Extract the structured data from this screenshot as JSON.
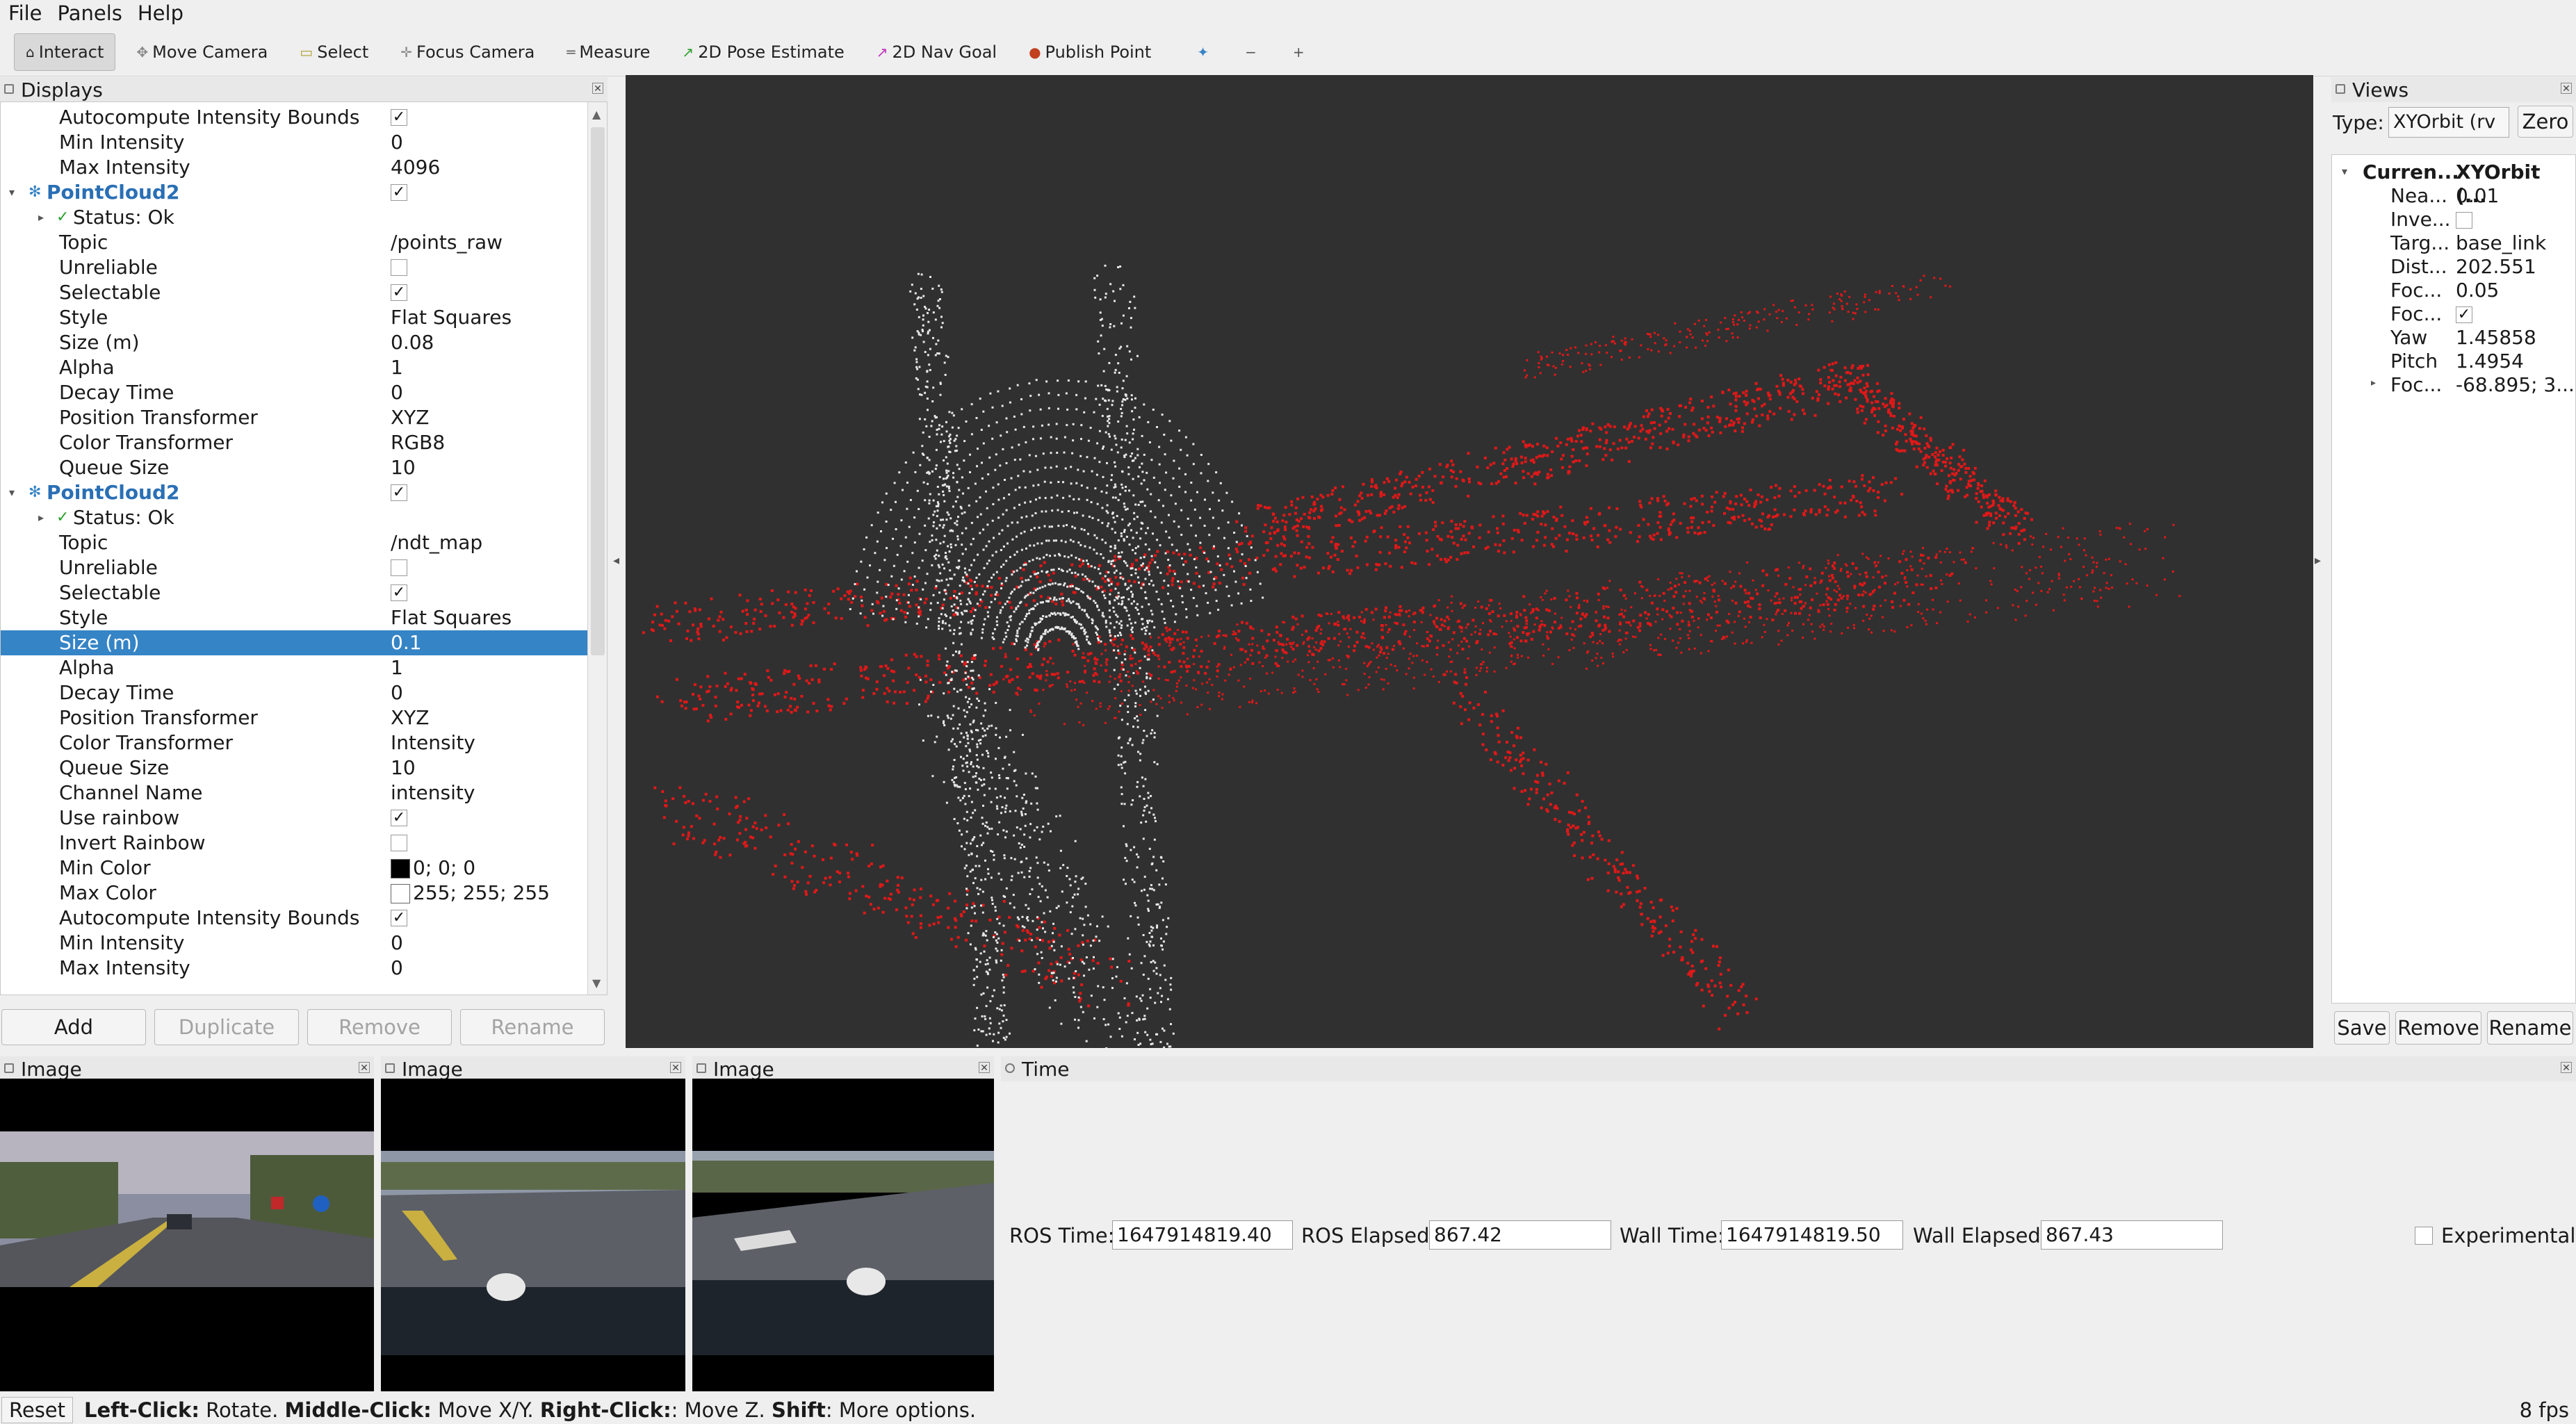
{
  "menu": {
    "file": "File",
    "panels": "Panels",
    "help": "Help"
  },
  "toolbar": {
    "interact": "Interact",
    "move_camera": "Move Camera",
    "select": "Select",
    "focus_camera": "Focus Camera",
    "measure": "Measure",
    "pose_estimate": "2D Pose Estimate",
    "nav_goal": "2D Nav Goal",
    "publish_point": "Publish Point"
  },
  "displays": {
    "title": "Displays",
    "rows": [
      {
        "key": "Autocompute Intensity Bounds",
        "checked": true
      },
      {
        "key": "Min Intensity",
        "value": "0"
      },
      {
        "key": "Max Intensity",
        "value": "4096"
      },
      {
        "key": "PointCloud2",
        "checked": true,
        "header": true
      },
      {
        "key": "Status: Ok",
        "status": true
      },
      {
        "key": "Topic",
        "value": "/points_raw"
      },
      {
        "key": "Unreliable",
        "checked": false
      },
      {
        "key": "Selectable",
        "checked": true
      },
      {
        "key": "Style",
        "value": "Flat Squares"
      },
      {
        "key": "Size (m)",
        "value": "0.08"
      },
      {
        "key": "Alpha",
        "value": "1"
      },
      {
        "key": "Decay Time",
        "value": "0"
      },
      {
        "key": "Position Transformer",
        "value": "XYZ"
      },
      {
        "key": "Color Transformer",
        "value": "RGB8"
      },
      {
        "key": "Queue Size",
        "value": "10"
      },
      {
        "key": "PointCloud2",
        "checked": true,
        "header": true
      },
      {
        "key": "Status: Ok",
        "status": true
      },
      {
        "key": "Topic",
        "value": "/ndt_map"
      },
      {
        "key": "Unreliable",
        "checked": false
      },
      {
        "key": "Selectable",
        "checked": true
      },
      {
        "key": "Style",
        "value": "Flat Squares"
      },
      {
        "key": "Size (m)",
        "value": "0.1",
        "selected": true
      },
      {
        "key": "Alpha",
        "value": "1"
      },
      {
        "key": "Decay Time",
        "value": "0"
      },
      {
        "key": "Position Transformer",
        "value": "XYZ"
      },
      {
        "key": "Color Transformer",
        "value": "Intensity"
      },
      {
        "key": "Queue Size",
        "value": "10"
      },
      {
        "key": "Channel Name",
        "value": "intensity"
      },
      {
        "key": "Use rainbow",
        "checked": true
      },
      {
        "key": "Invert Rainbow",
        "checked": false
      },
      {
        "key": "Min Color",
        "value": "0; 0; 0",
        "swatch": "#000000"
      },
      {
        "key": "Max Color",
        "value": "255; 255; 255",
        "swatch": "#ffffff"
      },
      {
        "key": "Autocompute Intensity Bounds",
        "checked": true
      },
      {
        "key": "Min Intensity",
        "value": "0"
      },
      {
        "key": "Max Intensity",
        "value": "0"
      }
    ],
    "buttons": {
      "add": "Add",
      "duplicate": "Duplicate",
      "remove": "Remove",
      "rename": "Rename"
    }
  },
  "views": {
    "title": "Views",
    "type_label": "Type:",
    "type_value": "XYOrbit (rv",
    "zero": "Zero",
    "header_key": "Curren...",
    "header_value": "XYOrbit (...",
    "rows": [
      {
        "key": "Nea...",
        "value": "0.01"
      },
      {
        "key": "Inve...",
        "checked": false
      },
      {
        "key": "Targ...",
        "value": "base_link"
      },
      {
        "key": "Dist...",
        "value": "202.551"
      },
      {
        "key": "Foc...",
        "value": "0.05"
      },
      {
        "key": "Foc...",
        "checked": true
      },
      {
        "key": "Yaw",
        "value": "1.45858"
      },
      {
        "key": "Pitch",
        "value": "1.4954"
      },
      {
        "key": "Foc...",
        "value": "-68.895; 3..."
      }
    ],
    "buttons": {
      "save": "Save",
      "remove": "Remove",
      "rename": "Rename"
    }
  },
  "image_panels": [
    {
      "title": "Image"
    },
    {
      "title": "Image"
    },
    {
      "title": "Image"
    }
  ],
  "time": {
    "title": "Time",
    "ros_time_label": "ROS Time:",
    "ros_time": "1647914819.40",
    "ros_elapsed_label": "ROS Elapsed:",
    "ros_elapsed": "867.42",
    "wall_time_label": "Wall Time:",
    "wall_time": "1647914819.50",
    "wall_elapsed_label": "Wall Elapsed:",
    "wall_elapsed": "867.43",
    "experimental": "Experimental"
  },
  "status": {
    "reset": "Reset",
    "left_click": "Left-Click:",
    "left_text": " Rotate. ",
    "middle_click": "Middle-Click:",
    "middle_text": " Move X/Y. ",
    "right_click": "Right-Click:",
    "right_text": ": Move Z. ",
    "shift": "Shift",
    "shift_text": ": More options.",
    "fps": "8 fps"
  }
}
